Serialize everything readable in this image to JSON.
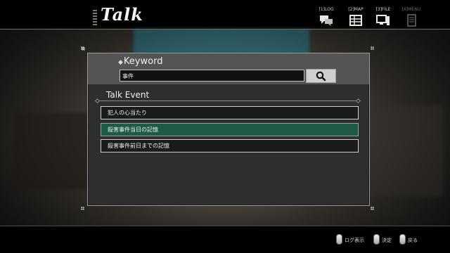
{
  "screen": {
    "title": "Talk"
  },
  "nav": [
    {
      "key": "[1]LOG",
      "icon": "log-chat-icon",
      "enabled": true
    },
    {
      "key": "[2]MAP",
      "icon": "map-icon",
      "enabled": true
    },
    {
      "key": "[3]FILE",
      "icon": "file-computer-icon",
      "enabled": true
    },
    {
      "key": "[6]MENU",
      "icon": "menu-notebook-icon",
      "enabled": false
    }
  ],
  "keyword": {
    "label": "Keyword",
    "value": "事件"
  },
  "search": {
    "icon": "search-icon"
  },
  "talk_event": {
    "title": "Talk Event",
    "items": [
      {
        "label": "犯人の心当たり",
        "selected": false
      },
      {
        "label": "殺害事件当日の記憶",
        "selected": true
      },
      {
        "label": "殺害事件前日までの記憶",
        "selected": false
      }
    ]
  },
  "controls": [
    {
      "label": "ログ表示",
      "icon": "button-hint-icon"
    },
    {
      "label": "決定",
      "icon": "button-hint-icon"
    },
    {
      "label": "戻る",
      "icon": "button-hint-icon"
    }
  ],
  "colors": {
    "selected_row": "#1f5a49",
    "selected_border": "#5fbf99",
    "panel": "#2e2e2e",
    "header": "#545454"
  }
}
